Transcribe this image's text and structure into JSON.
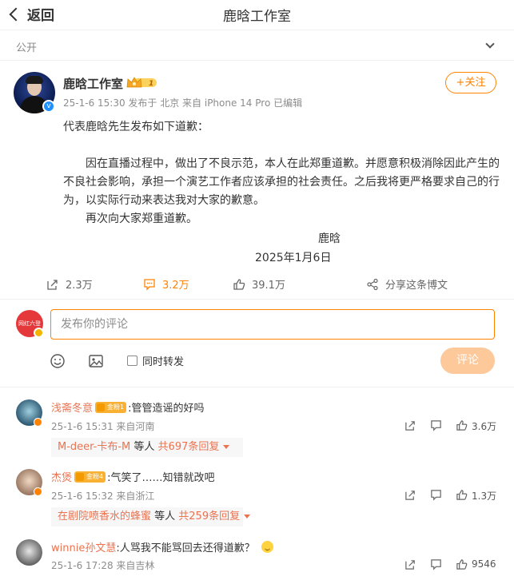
{
  "nav": {
    "back_label": "返回",
    "title": "鹿晗工作室"
  },
  "visibility": {
    "label": "公开"
  },
  "post": {
    "author": "鹿晗工作室",
    "badge_level": "1",
    "meta": "25-1-6 15:30 发布于 北京  来自 iPhone 14 Pro 已编辑",
    "follow_label": "+关注",
    "lines": {
      "intro": "代表鹿晗先生发布如下道歉：",
      "para1": "因在直播过程中，做出了不良示范，本人在此郑重道歉。并愿意积极消除因此产生的不良社会影响，承担一个演艺工作者应该承担的社会责任。之后我将更严格要求自己的行为，以实际行动来表达我对大家的歉意。",
      "para2": "再次向大家郑重道歉。",
      "signature": "鹿晗",
      "date": "2025年1月6日"
    },
    "stats": {
      "reposts": "2.3万",
      "comments": "3.2万",
      "likes": "39.1万",
      "share_label": "分享这条博文"
    }
  },
  "composer": {
    "avatar_text": "网红六登",
    "placeholder": "发布你的评论",
    "repost_label": "同时转发",
    "submit_label": "评论"
  },
  "comments": [
    {
      "name": "浅斋冬意",
      "fan_badge": "金粉1",
      "text": ":管管造谣的好吗",
      "meta": "25-1-6 15:31 来自河南",
      "likes": "3.6万",
      "reply_user": "M-deer-卡布-M",
      "reply_mid": " 等人 ",
      "reply_count": "共697条回复"
    },
    {
      "name": "杰煲",
      "fan_badge": "金粉4",
      "text": ":气笑了……知错就改吧",
      "meta": "25-1-6 15:32 来自浙江",
      "likes": "1.3万",
      "reply_user": "在剧院喷香水的蜂蜜",
      "reply_mid": " 等人 ",
      "reply_count": "共259条回复"
    },
    {
      "name": "winnie孙文慧",
      "text": ":人骂我不能骂回去还得道歉？",
      "meta": "25-1-6 17:28 来自吉林",
      "likes": "9546"
    }
  ],
  "colors": {
    "accent": "#ff8200",
    "link": "#eb7350",
    "submit_disabled": "#fdc89a"
  }
}
